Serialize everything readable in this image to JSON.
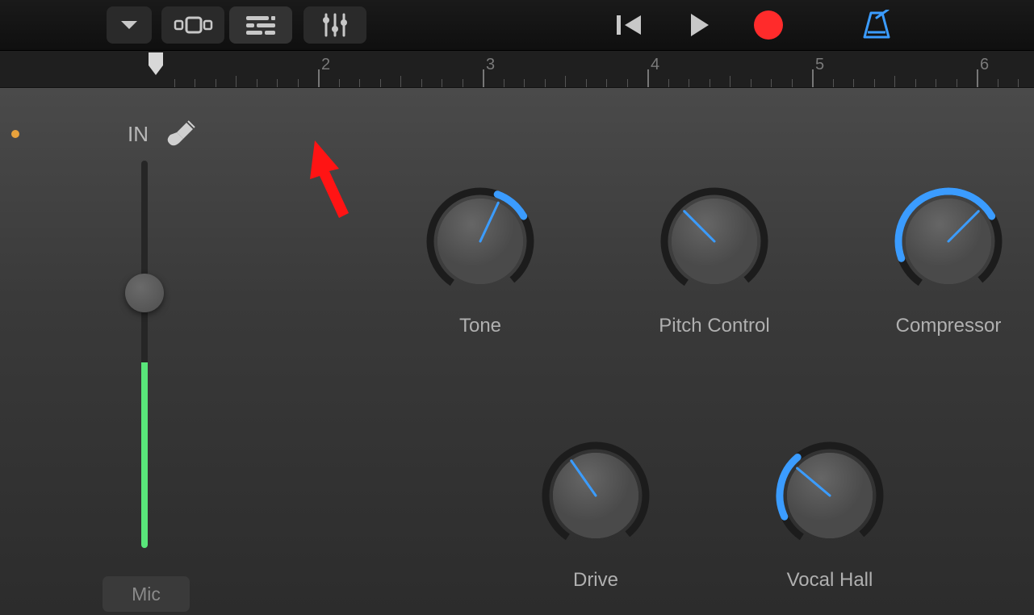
{
  "toolbar": {
    "buttons": [
      "dropdown",
      "browser",
      "tracks",
      "mixer"
    ]
  },
  "transport": {
    "rewind": "rewind",
    "play": "play",
    "record": "record",
    "metronome": "metronome"
  },
  "ruler": {
    "marks": [
      2,
      3,
      4,
      5,
      6
    ]
  },
  "sidebar": {
    "in_label": "IN",
    "mic_label": "Mic"
  },
  "knobs": {
    "row1": [
      {
        "label": "Tone",
        "angle": 25,
        "arc_start": 20,
        "arc_end": 60
      },
      {
        "label": "Pitch Control",
        "angle": -45,
        "arc_start": 0,
        "arc_end": 0
      },
      {
        "label": "Compressor",
        "angle": 45,
        "arc_start": -110,
        "arc_end": 60
      }
    ],
    "row2": [
      {
        "label": "Drive",
        "angle": -35,
        "arc_start": 0,
        "arc_end": 0
      },
      {
        "label": "Vocal Hall",
        "angle": -50,
        "arc_start": -115,
        "arc_end": -40
      }
    ]
  },
  "colors": {
    "accent": "#3b9cff",
    "record": "#ff2b2b",
    "level": "#59e67a"
  }
}
